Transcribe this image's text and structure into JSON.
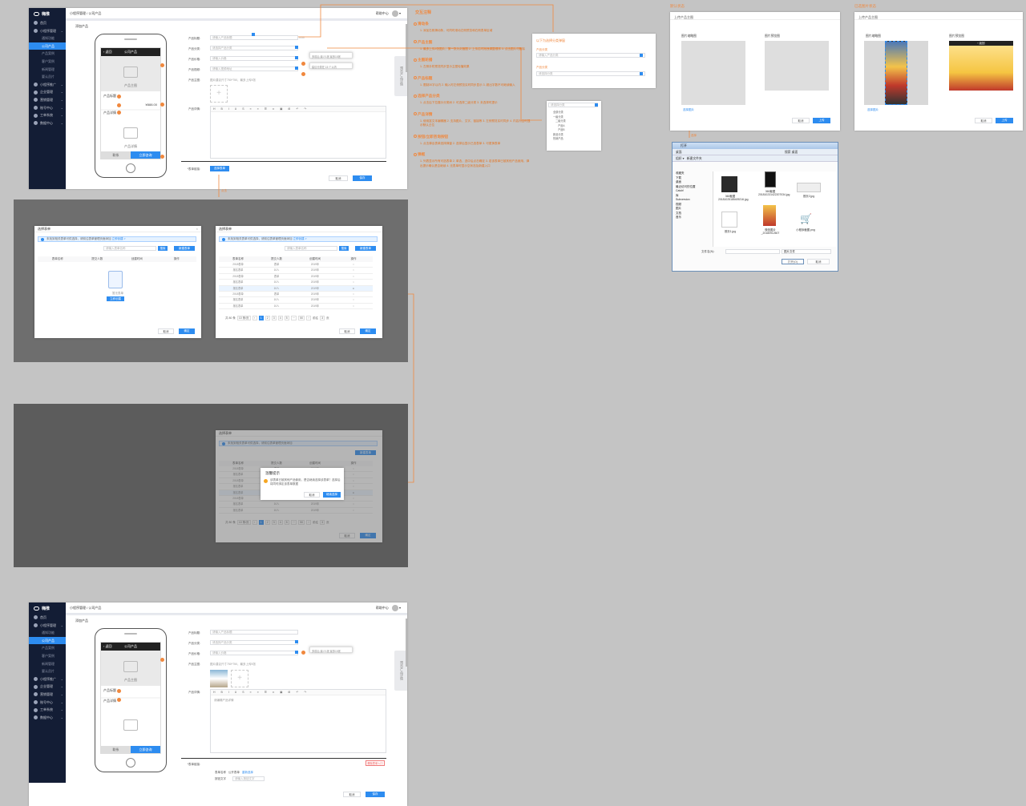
{
  "colors": {
    "accent": "#2d8cf0",
    "annotation": "#f0883e",
    "sidebar": "#131d35",
    "canvas": "#c4c4c4"
  },
  "sidebar": {
    "logo": "嗨推",
    "items": [
      {
        "label": "首页",
        "icon": "home-icon"
      },
      {
        "label": "小程序管理",
        "icon": "grid-icon"
      },
      {
        "label": "通知功能",
        "sub": true
      },
      {
        "label": "公司产品",
        "sub": true,
        "active": true
      },
      {
        "label": "产品案例",
        "sub": true
      },
      {
        "label": "客户案例",
        "sub": true
      },
      {
        "label": "新闻管理",
        "sub": true
      },
      {
        "label": "要认员片",
        "sub": true
      },
      {
        "label": "小程序推广",
        "icon": "share-icon"
      },
      {
        "label": "企业管理",
        "icon": "building-icon"
      },
      {
        "label": "营销管理",
        "icon": "megaphone-icon"
      },
      {
        "label": "账号中心",
        "icon": "user-icon"
      },
      {
        "label": "工单系统",
        "icon": "ticket-icon"
      },
      {
        "label": "数据中心",
        "icon": "chart-icon"
      }
    ]
  },
  "topbar": {
    "breadcrumb": "小程序管理 / 公司产品",
    "help": "帮助中心"
  },
  "form": {
    "page_title": "添加产品",
    "phone": {
      "app_title": "公司产品",
      "main_image": "产品主图",
      "product_name": "产品标题",
      "price": "¥888.00",
      "detail_title": "产品详情",
      "detail_img": "产品详情",
      "btn_left": "联系",
      "btn_right": "立即咨询"
    },
    "labels": {
      "name": "产品标题:",
      "category": "产品分类:",
      "price": "产品价格:",
      "video": "产品视频:",
      "main_img": "产品主图:",
      "detail": "产品详情:",
      "form": "*表单链接:"
    },
    "placeholders": {
      "name": "请输入产品标题",
      "category": "请选择产品分类",
      "price": "请输入价格",
      "video": "请输入视频地址"
    },
    "hints": {
      "counter": "0/30",
      "tip1": "多前后 最少1张 最多15张",
      "tip2": "建议分类在 15 个以内",
      "main_img_tip": "图片建议尺寸750*750，最多上传5张"
    },
    "toolbar": "H  B  I  U  S  ≡  ≡  ☰  ∞  ▣  ⊞  ↶  ↷",
    "form_btn": "选择表单",
    "cancel": "取消",
    "save": "保存",
    "preview_tab": "预览产品详情"
  },
  "notes": {
    "title": "交互注释",
    "sections": [
      {
        "h": "滑动条",
        "t": "1. 添加右侧滑动条，可同时滚动左侧预览和右侧表单区域"
      },
      {
        "h": "产品主图",
        "t": "1. 最多上传5张图片，第一张为封面图 2. 上传后可拖拽调整顺序 3. 点击图片可删除"
      },
      {
        "h": "主图轮播",
        "t": "1. 左侧手机预览同步显示主图轮播效果"
      },
      {
        "h": "产品标题",
        "t": "1. 限制30字以内 2. 输入时左侧预览实时同步显示 3. 超出字数不可继续输入"
      },
      {
        "h": "选择产品分类",
        "t": "1. 点击后下拉展示分类树 2. 可选择二级分类 3. 未选择时提示"
      },
      {
        "h": "产品详情",
        "t": "1. 使用富文本编辑器 2. 支持图片、文字、链接等 3. 左侧预览实时同步 4. 内容为空时显示默认占位"
      },
      {
        "h": "按钮/立即咨询按钮",
        "t": "1. 点击弹出表单选择弹窗 2. 选择后显示已选表单 3. 可更换表单"
      },
      {
        "h": "弹框",
        "t": "1. 列表显示所有可选表单 2. 单选，选中后点击确定 3. 若该表单已被其他产品使用，弹出提示确认是否继续 4. 无表单时显示空状态及新建入口"
      }
    ]
  },
  "popup_hint": {
    "title": "以下为选择分类弹窗",
    "l1": "产品分类",
    "v1": "请输入产品分类",
    "l2": "产品分类",
    "v2": "请选择分类"
  },
  "tree": {
    "placeholder": "请选择分类",
    "items": [
      "全部分类",
      "一级分类",
      "二级分类",
      "产品A",
      "产品B",
      "新品分类",
      "热销产品"
    ]
  },
  "dlg": {
    "title": "选择表单",
    "info": "未找到相关表单可供选择，请前往表单管理页面添加",
    "link": "立即创建 >",
    "search_ph": "请输入表单名称",
    "search_btn": "搜索",
    "new_btn": "新建表单",
    "cols": [
      "表单名称",
      "提交人数",
      "创建时间",
      "操作"
    ],
    "empty_text": "暂无表单",
    "empty_btn": "立即创建",
    "rows": [
      [
        "2018表单",
        "表单",
        "2019年",
        "○"
      ],
      [
        "报名表单",
        "10人",
        "2019年",
        "○"
      ],
      [
        "2018表单",
        "表单",
        "2019年",
        "○"
      ],
      [
        "报名表单",
        "10人",
        "2019年",
        "○"
      ],
      [
        "报名表单",
        "10人",
        "2019年",
        "●"
      ],
      [
        "2018表单",
        "表单",
        "2019年",
        "○"
      ],
      [
        "报名表单",
        "10人",
        "2019年",
        "○"
      ],
      [
        "报名表单",
        "10人",
        "2019年",
        "○"
      ]
    ],
    "total": "共 80 条",
    "per_page": "10 条/页",
    "pages": [
      "‹",
      "1",
      "2",
      "3",
      "4",
      "5",
      "···",
      "50",
      "›"
    ],
    "goto": "前往",
    "goto_page": "3",
    "page_unit": "页",
    "cancel": "取消",
    "ok": "确定"
  },
  "confirm": {
    "title": "温馨提示",
    "text": "该表单已被其他产品使用，是否继续选择该表单？选择后将同时绑定该表单数据",
    "cancel": "取消",
    "ok": "继续选择"
  },
  "upload": {
    "header_default": "默认状态",
    "header_done": "已选图片状态",
    "win_title": "上传产品主图",
    "col1": "图片缩略图",
    "col2": "图片预览图",
    "pick": "选择图片",
    "cancel": "取消",
    "ok": "上传"
  },
  "filedlg": {
    "title": "打开",
    "path": "桌面",
    "search": "搜索 桌面",
    "organize": "组织 ▾",
    "newfolder": "新建文件夹",
    "tree": [
      "收藏夹",
      "下载",
      "桌面",
      "最近访问的位置",
      "Catch!",
      "库",
      "Subversion",
      "视频",
      "图片",
      "文档",
      "音乐"
    ],
    "files": [
      "360截图20181025185409216.jpg",
      "360截图201810231422207034.jpg",
      "首页2.jpg",
      "首页1.jpg",
      "微信图片_20180912607",
      "小程序截图.png"
    ],
    "fname_label": "文件名(N):",
    "ftype": "图片文件",
    "open": "打开(O)",
    "cancel": "取消"
  },
  "filled": {
    "detail_text": "请编辑产品详情",
    "form_type_label": "表单名称",
    "form_type": "公开表单",
    "form_link": "重新选择",
    "btn_text_label": "按钮文字",
    "btn_text_ph": "请输入按钮文字",
    "delete_btn": "删除表单入口"
  },
  "arrow_labels": {
    "click": "点击",
    "select": "选择"
  }
}
